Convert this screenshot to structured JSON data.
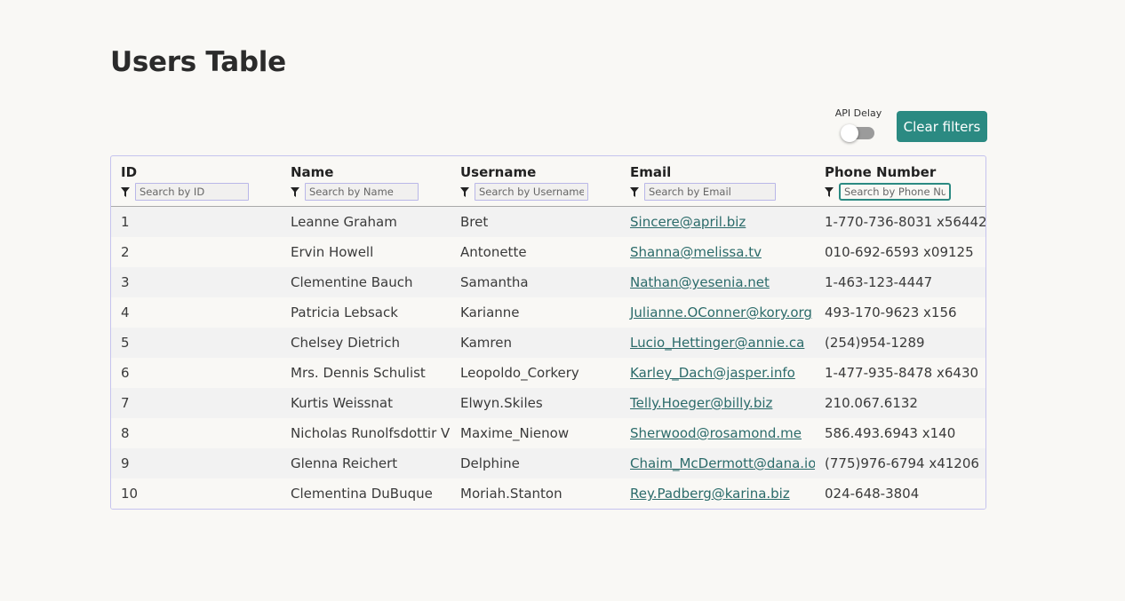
{
  "page": {
    "title": "Users Table"
  },
  "controls": {
    "api_delay_label": "API Delay",
    "api_delay_enabled": false,
    "clear_filters_label": "Clear filters"
  },
  "table": {
    "columns": [
      {
        "title": "ID",
        "placeholder": "Search by ID",
        "filter_value": ""
      },
      {
        "title": "Name",
        "placeholder": "Search by Name",
        "filter_value": ""
      },
      {
        "title": "Username",
        "placeholder": "Search by Username",
        "filter_value": ""
      },
      {
        "title": "Email",
        "placeholder": "Search by Email",
        "filter_value": ""
      },
      {
        "title": "Phone Number",
        "placeholder": "Search by Phone Number",
        "filter_value": ""
      }
    ],
    "rows": [
      {
        "id": "1",
        "name": "Leanne Graham",
        "username": "Bret",
        "email": "Sincere@april.biz",
        "phone": "1-770-736-8031 x56442"
      },
      {
        "id": "2",
        "name": "Ervin Howell",
        "username": "Antonette",
        "email": "Shanna@melissa.tv",
        "phone": "010-692-6593 x09125"
      },
      {
        "id": "3",
        "name": "Clementine Bauch",
        "username": "Samantha",
        "email": "Nathan@yesenia.net",
        "phone": "1-463-123-4447"
      },
      {
        "id": "4",
        "name": "Patricia Lebsack",
        "username": "Karianne",
        "email": "Julianne.OConner@kory.org",
        "phone": "493-170-9623 x156"
      },
      {
        "id": "5",
        "name": "Chelsey Dietrich",
        "username": "Kamren",
        "email": "Lucio_Hettinger@annie.ca",
        "phone": "(254)954-1289"
      },
      {
        "id": "6",
        "name": "Mrs. Dennis Schulist",
        "username": "Leopoldo_Corkery",
        "email": "Karley_Dach@jasper.info",
        "phone": "1-477-935-8478 x6430"
      },
      {
        "id": "7",
        "name": "Kurtis Weissnat",
        "username": "Elwyn.Skiles",
        "email": "Telly.Hoeger@billy.biz",
        "phone": "210.067.6132"
      },
      {
        "id": "8",
        "name": "Nicholas Runolfsdottir V",
        "username": "Maxime_Nienow",
        "email": "Sherwood@rosamond.me",
        "phone": "586.493.6943 x140"
      },
      {
        "id": "9",
        "name": "Glenna Reichert",
        "username": "Delphine",
        "email": "Chaim_McDermott@dana.io",
        "phone": "(775)976-6794 x41206"
      },
      {
        "id": "10",
        "name": "Clementina DuBuque",
        "username": "Moriah.Stanton",
        "email": "Rey.Padberg@karina.biz",
        "phone": "024-648-3804"
      }
    ]
  },
  "colors": {
    "accent": "#2b8a82",
    "link": "#2b6b6a",
    "table_border": "#c5c3ee",
    "row_striped": "#f2f2f2",
    "background": "#f9f8f5"
  }
}
